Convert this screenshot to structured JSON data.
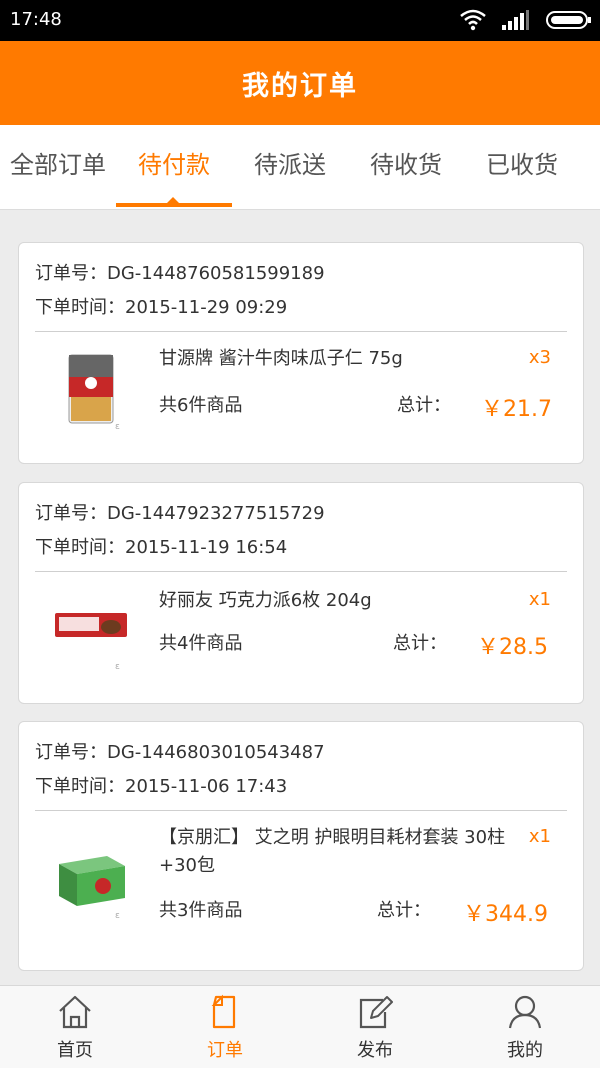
{
  "status_bar": {
    "time": "17:48"
  },
  "header": {
    "title": "我的订单"
  },
  "tabs": [
    {
      "label": "全部订单"
    },
    {
      "label": "待付款"
    },
    {
      "label": "待派送"
    },
    {
      "label": "待收货"
    },
    {
      "label": "已收货"
    }
  ],
  "active_tab_index": 1,
  "orders": [
    {
      "order_id": "订单号：DG-1448760581599189",
      "order_time": "下单时间：2015-11-29 09:29",
      "product_name": "甘源牌 酱汁牛肉味瓜子仁 75g",
      "quantity": "x3",
      "item_count": "共6件商品",
      "total_label": "总计：",
      "total_price": "￥21.7"
    },
    {
      "order_id": "订单号：DG-1447923277515729",
      "order_time": "下单时间：2015-11-19 16:54",
      "product_name": "好丽友 巧克力派6枚 204g",
      "quantity": "x1",
      "item_count": "共4件商品",
      "total_label": "总计：",
      "total_price": "￥28.5"
    },
    {
      "order_id": "订单号：DG-1446803010543487",
      "order_time": "下单时间：2015-11-06 17:43",
      "product_name": "【京朋汇】 艾之明 护眼明目耗材套装 30柱+30包",
      "quantity": "x1",
      "item_count": "共3件商品",
      "total_label": "总计：",
      "total_price": "￥344.9"
    }
  ],
  "bottom_nav": [
    {
      "label": "首页",
      "icon": "home-icon"
    },
    {
      "label": "订单",
      "icon": "order-icon"
    },
    {
      "label": "发布",
      "icon": "edit-icon"
    },
    {
      "label": "我的",
      "icon": "user-icon"
    }
  ],
  "colors": {
    "accent": "#ff7a00",
    "status_bar": "#000000"
  }
}
